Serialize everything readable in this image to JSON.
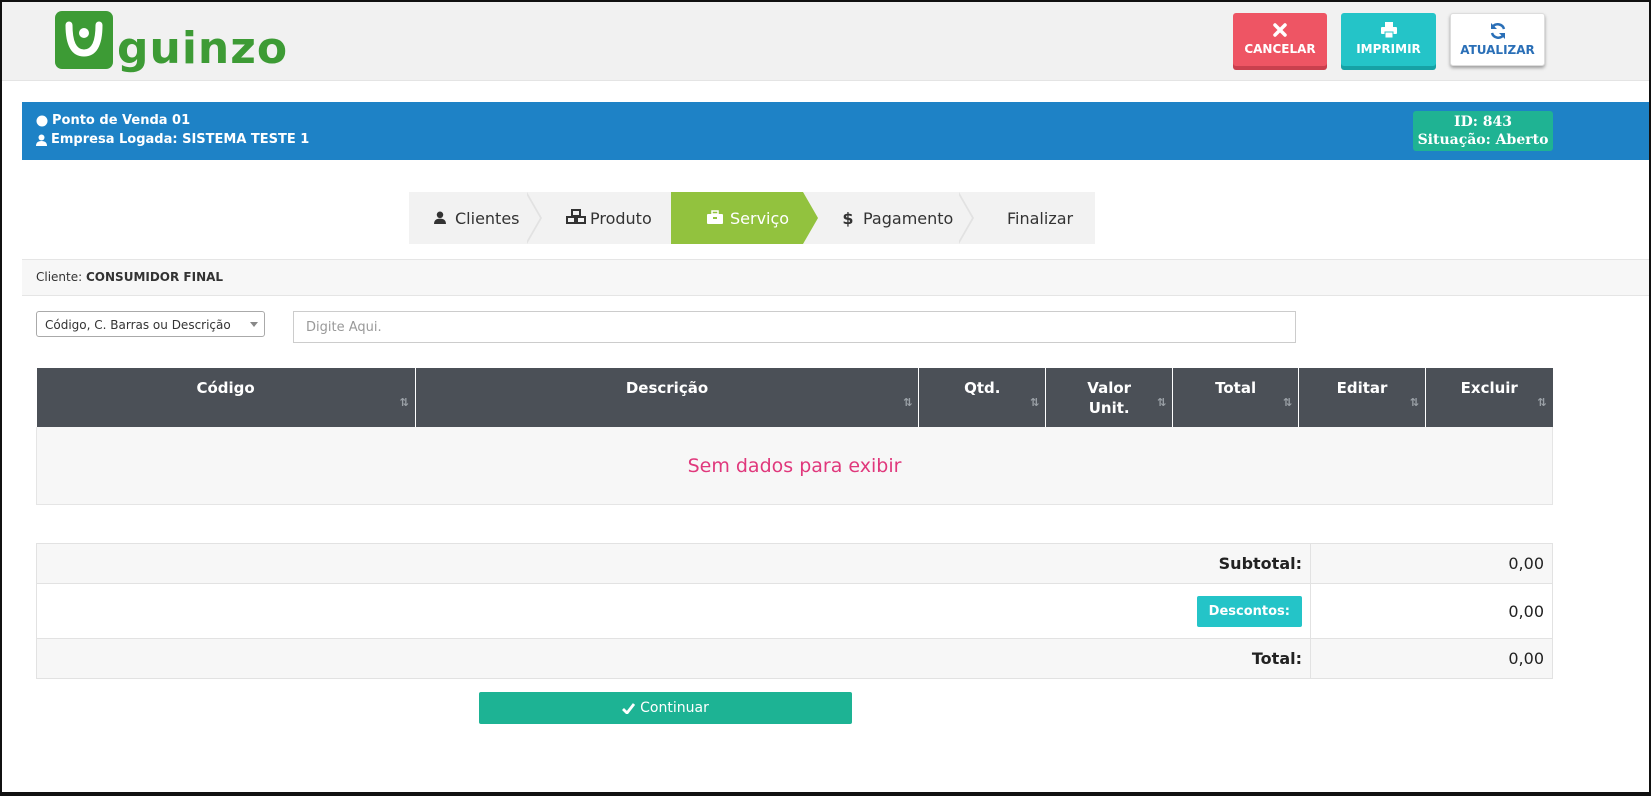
{
  "app": {
    "logo_text": "guinzo",
    "brand_color": "#3d9b35"
  },
  "toolbar": {
    "cancel_label": "CANCELAR",
    "print_label": "IMPRIMIR",
    "update_label": "ATUALIZAR",
    "cancel_icon": "close-icon",
    "print_icon": "printer-icon",
    "update_icon": "refresh-icon"
  },
  "session": {
    "pos_name": "Ponto de Venda 01",
    "company": "Empresa Logada: SISTEMA TESTE 1",
    "id_text": "ID: 843",
    "status_text": "Situação: Aberto",
    "bar_color": "#1e82c6",
    "status_color": "#1fb393"
  },
  "steps": [
    {
      "label": "Clientes",
      "icon": "user-icon"
    },
    {
      "label": "Produto",
      "icon": "cubes-icon"
    },
    {
      "label": "Serviço",
      "icon": "briefcase-icon",
      "active": true
    },
    {
      "label": "Pagamento",
      "icon": "dollar-icon"
    },
    {
      "label": "Finalizar",
      "icon": ""
    }
  ],
  "client": {
    "label": "Cliente:",
    "value": "CONSUMIDOR FINAL"
  },
  "search": {
    "mode_selected": "Código, C. Barras ou Descrição",
    "placeholder": "Digite Aqui."
  },
  "table": {
    "columns": [
      "Código",
      "Descrição",
      "Qtd.",
      "Valor Unit.",
      "Total",
      "Editar",
      "Excluir"
    ],
    "empty_message": "Sem dados para exibir"
  },
  "totals": {
    "subtotal_label": "Subtotal:",
    "subtotal_value": "0,00",
    "discount_label": "Descontos:",
    "discount_value": "0,00",
    "total_label": "Total:",
    "total_value": "0,00"
  },
  "footer": {
    "continue_label": "Continuar"
  }
}
